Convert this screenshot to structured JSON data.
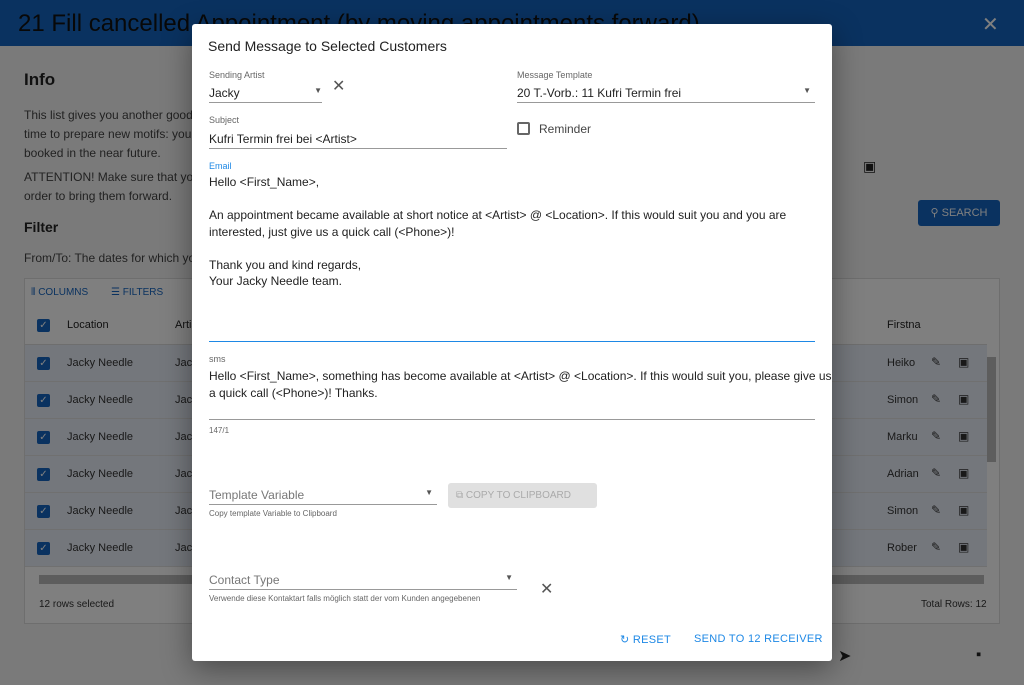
{
  "page": {
    "title": "21 Fill cancelled Appointment (by moving appointments forward)",
    "info_heading": "Info",
    "info_lines": [
      "This list gives you another good",
      "time to prepare new motifs: you c",
      "booked in the near future."
    ],
    "attention_lines": [
      "ATTENTION! Make sure that you",
      "order to bring them forward."
    ],
    "filter_heading": "Filter",
    "filter_text": "From/To: The dates for which yo",
    "search_label": "SEARCH"
  },
  "grid": {
    "toolbar": {
      "columns": "COLUMNS",
      "filters": "FILTERS"
    },
    "headers": {
      "location": "Location",
      "artist": "Artis",
      "firstname": "Firstna"
    },
    "rows": [
      {
        "location": "Jacky Needle",
        "artist": "Jack",
        "firstname": "Heiko"
      },
      {
        "location": "Jacky Needle",
        "artist": "Jack",
        "firstname": "Simon"
      },
      {
        "location": "Jacky Needle",
        "artist": "Jack",
        "firstname": "Marku"
      },
      {
        "location": "Jacky Needle",
        "artist": "Jack",
        "firstname": "Adrian"
      },
      {
        "location": "Jacky Needle",
        "artist": "Jack",
        "firstname": "Simon"
      },
      {
        "location": "Jacky Needle",
        "artist": "Jack",
        "firstname": "Rober"
      }
    ],
    "selected": "12 rows selected",
    "total": "Total Rows: 12"
  },
  "modal": {
    "title": "Send Message to Selected Customers",
    "artist_label": "Sending Artist",
    "artist_value": "Jacky",
    "template_label": "Message Template",
    "template_value": "20 T.-Vorb.: 11 Kufri Termin frei",
    "subject_label": "Subject",
    "subject_value": "Kufri Termin frei bei <Artist>",
    "reminder_label": "Reminder",
    "reminder_checked": false,
    "email_label": "Email",
    "email_lines": [
      "Hello <First_Name>,",
      "",
      "An appointment became available at short notice at <Artist> @ <Location>. If this would suit you and you are",
      "interested, just give us a quick call (<Phone>)!",
      "",
      "Thank you and kind regards,",
      "Your Jacky Needle team."
    ],
    "sms_label": "sms",
    "sms_lines": [
      "Hello <First_Name>, something has become available at <Artist> @ <Location>. If this would suit you, please give us",
      "a quick call (<Phone>)! Thanks."
    ],
    "sms_count": "147/1",
    "template_var_placeholder": "Template Variable",
    "template_var_help": "Copy template Variable to Clipboard",
    "copy_label": "COPY TO CLIPBOARD",
    "contact_placeholder": "Contact Type",
    "contact_help": "Verwende diese Kontaktart falls möglich statt der vom Kunden angegebenen",
    "reset_label": "RESET",
    "send_label": "SEND TO 12 RECEIVER"
  },
  "colors": {
    "primary": "#1565c0",
    "accent": "#1e88e5"
  }
}
